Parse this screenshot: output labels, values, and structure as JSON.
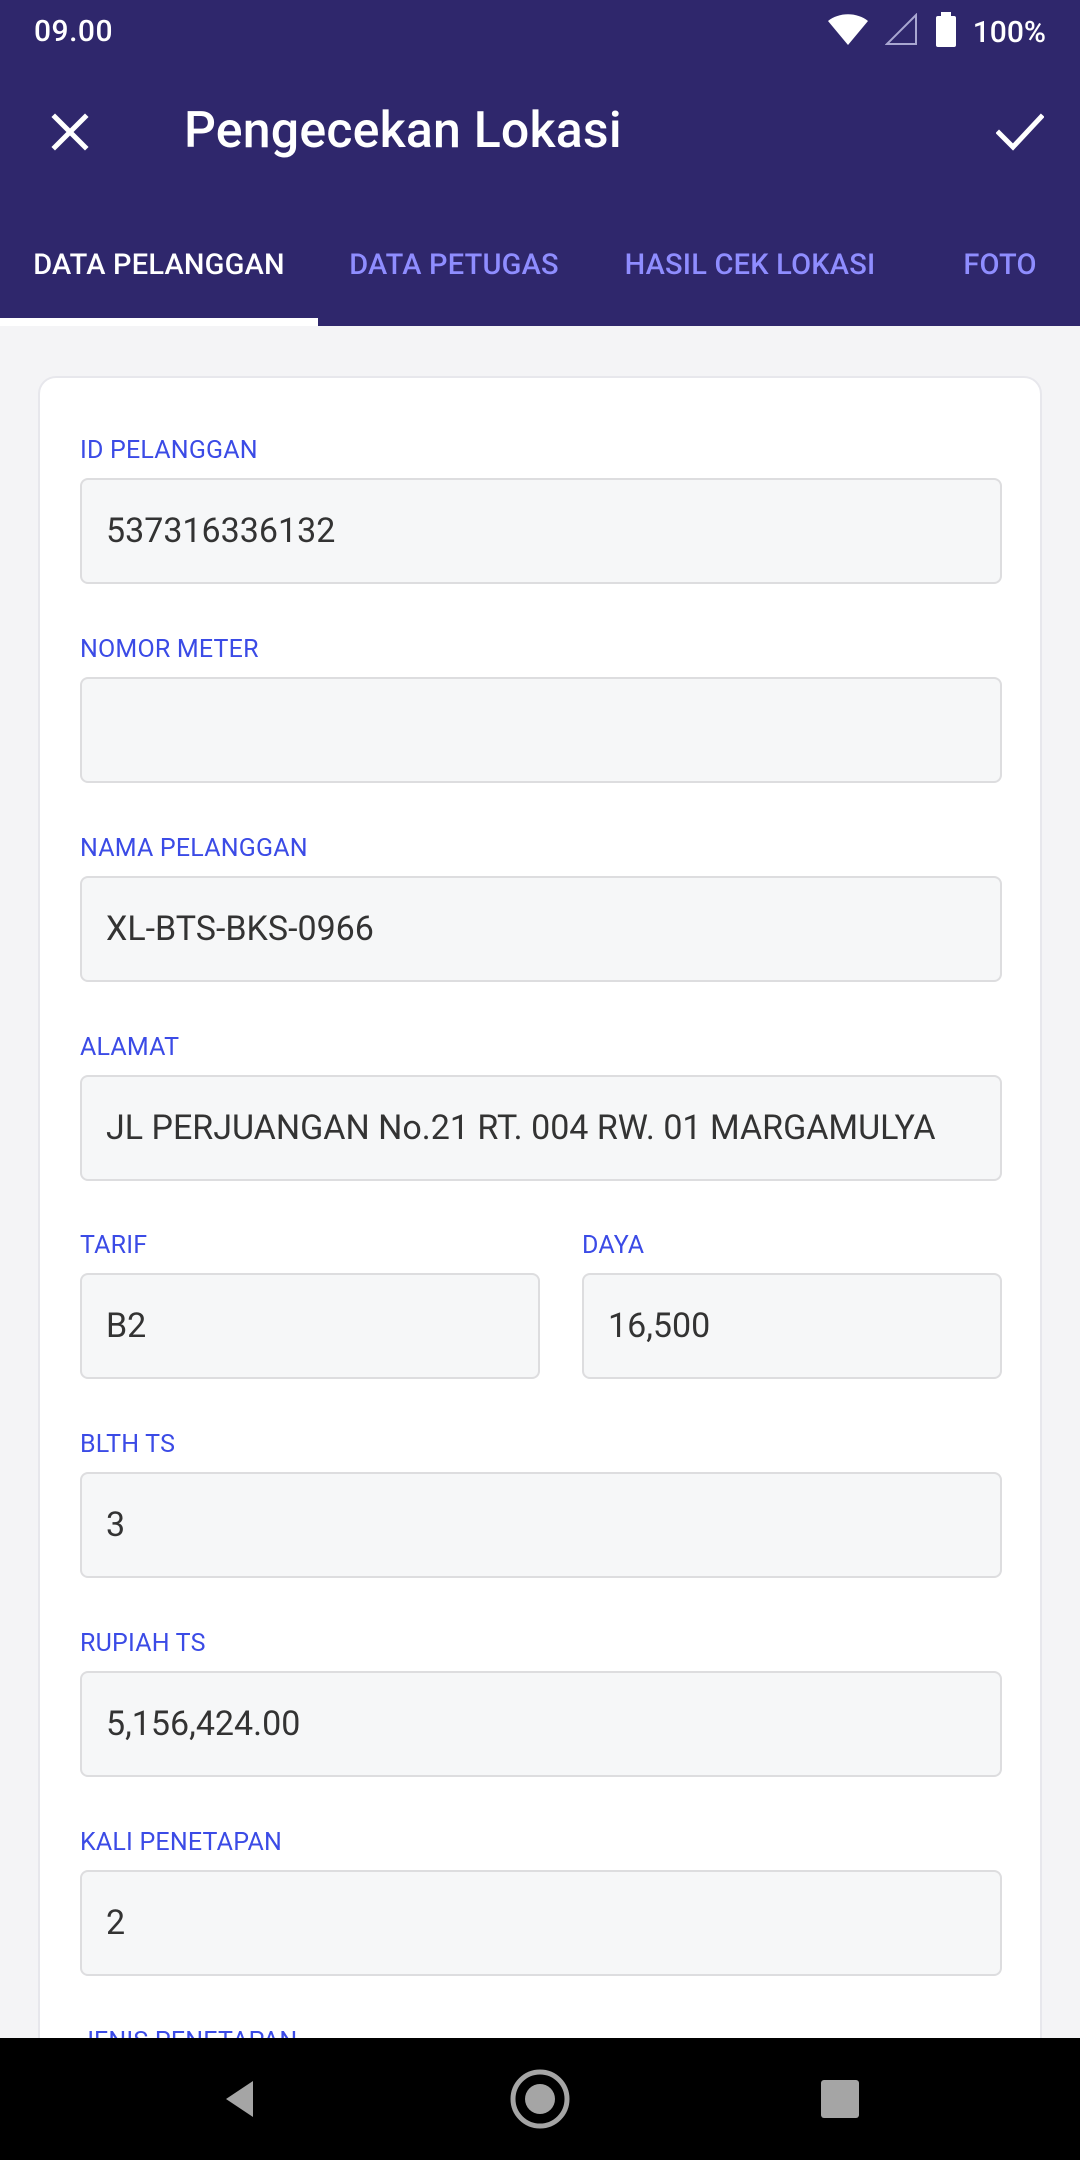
{
  "status_bar": {
    "time": "09.00",
    "battery_percent": "100%",
    "icons": [
      "wifi-icon",
      "signal-icon",
      "battery-icon"
    ]
  },
  "toolbar": {
    "title": "Pengecekan Lokasi",
    "close_icon": "close-icon",
    "confirm_icon": "check-icon"
  },
  "tabs": [
    {
      "label": "DATA PELANGGAN",
      "active": true
    },
    {
      "label": "DATA PETUGAS",
      "active": false
    },
    {
      "label": "HASIL CEK LOKASI",
      "active": false
    },
    {
      "label": "FOTO",
      "active": false
    }
  ],
  "form": {
    "id_pelanggan": {
      "label": "ID PELANGGAN",
      "value": "537316336132"
    },
    "nomor_meter": {
      "label": "NOMOR METER",
      "value": ""
    },
    "nama_pelanggan": {
      "label": "NAMA PELANGGAN",
      "value": "XL-BTS-BKS-0966"
    },
    "alamat": {
      "label": "ALAMAT",
      "value": "JL PERJUANGAN No.21 RT. 004 RW. 01 MARGAMULYA"
    },
    "tarif": {
      "label": "TARIF",
      "value": "B2"
    },
    "daya": {
      "label": "DAYA",
      "value": "16,500"
    },
    "blth_ts": {
      "label": "BLTH TS",
      "value": "3"
    },
    "rupiah_ts": {
      "label": "RUPIAH TS",
      "value": "5,156,424.00"
    },
    "kali_penetapan": {
      "label": "KALI PENETAPAN",
      "value": "2"
    },
    "jenis_penetapan": {
      "label": "JENIS PENETAPAN"
    }
  },
  "nav": {
    "back_icon": "back-icon",
    "home_icon": "home-icon",
    "recents_icon": "recents-icon"
  },
  "colors": {
    "header": "#2f276c",
    "active_tab": "#ffffff",
    "inactive_tab": "#8f8dff",
    "label": "#3b4be6",
    "input_bg": "#f6f7f8"
  }
}
